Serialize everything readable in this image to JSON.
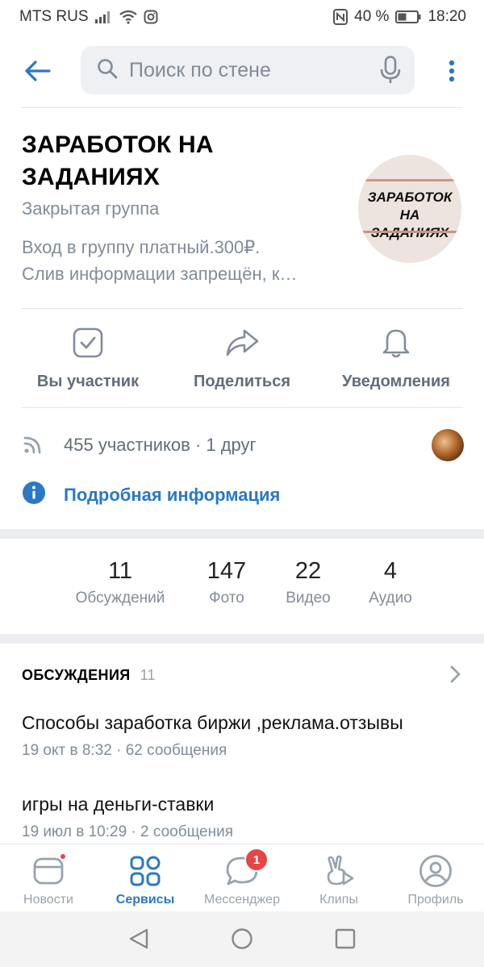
{
  "status_bar": {
    "carrier": "MTS RUS",
    "battery": "40 %",
    "time": "18:20"
  },
  "header": {
    "search_placeholder": "Поиск по стене"
  },
  "group": {
    "title_line1": "ЗАРАБОТОК НА",
    "title_line2": "ЗАДАНИЯХ",
    "type": "Закрытая группа",
    "desc_line1": "Вход в группу платный.300₽.",
    "desc_line2": "Слив информации  запрещён, к…",
    "avatar_text_line1": "ЗАРАБОТОК НА",
    "avatar_text_line2": "ЗАДАНИЯХ"
  },
  "actions": [
    {
      "label": "Вы участник",
      "icon": "checkbox-icon"
    },
    {
      "label": "Поделиться",
      "icon": "share-icon"
    },
    {
      "label": "Уведомления",
      "icon": "bell-icon"
    }
  ],
  "members": {
    "text": "455 участников · 1 друг",
    "info_link": "Подробная информация"
  },
  "counters": [
    {
      "num": "11",
      "caption": "Обсуждений"
    },
    {
      "num": "147",
      "caption": "Фото"
    },
    {
      "num": "22",
      "caption": "Видео"
    },
    {
      "num": "4",
      "caption": "Аудио"
    }
  ],
  "discussions": {
    "title": "ОБСУЖДЕНИЯ",
    "count": "11",
    "topics": [
      {
        "title": "Способы заработка биржи ,реклама.отзывы",
        "meta": "19 окт в 8:32 · 62 сообщения"
      },
      {
        "title": "игры на деньги-ставки",
        "meta": "19 июл в 10:29 · 2 сообщения"
      }
    ]
  },
  "tabbar": {
    "tabs": [
      {
        "label": "Новости"
      },
      {
        "label": "Сервисы"
      },
      {
        "label": "Мессенджер"
      },
      {
        "label": "Клипы"
      },
      {
        "label": "Профиль"
      }
    ],
    "messenger_badge": "1"
  },
  "colors": {
    "accent": "#2a78c6",
    "secondary_text": "#818c99",
    "badge": "#e64646"
  }
}
